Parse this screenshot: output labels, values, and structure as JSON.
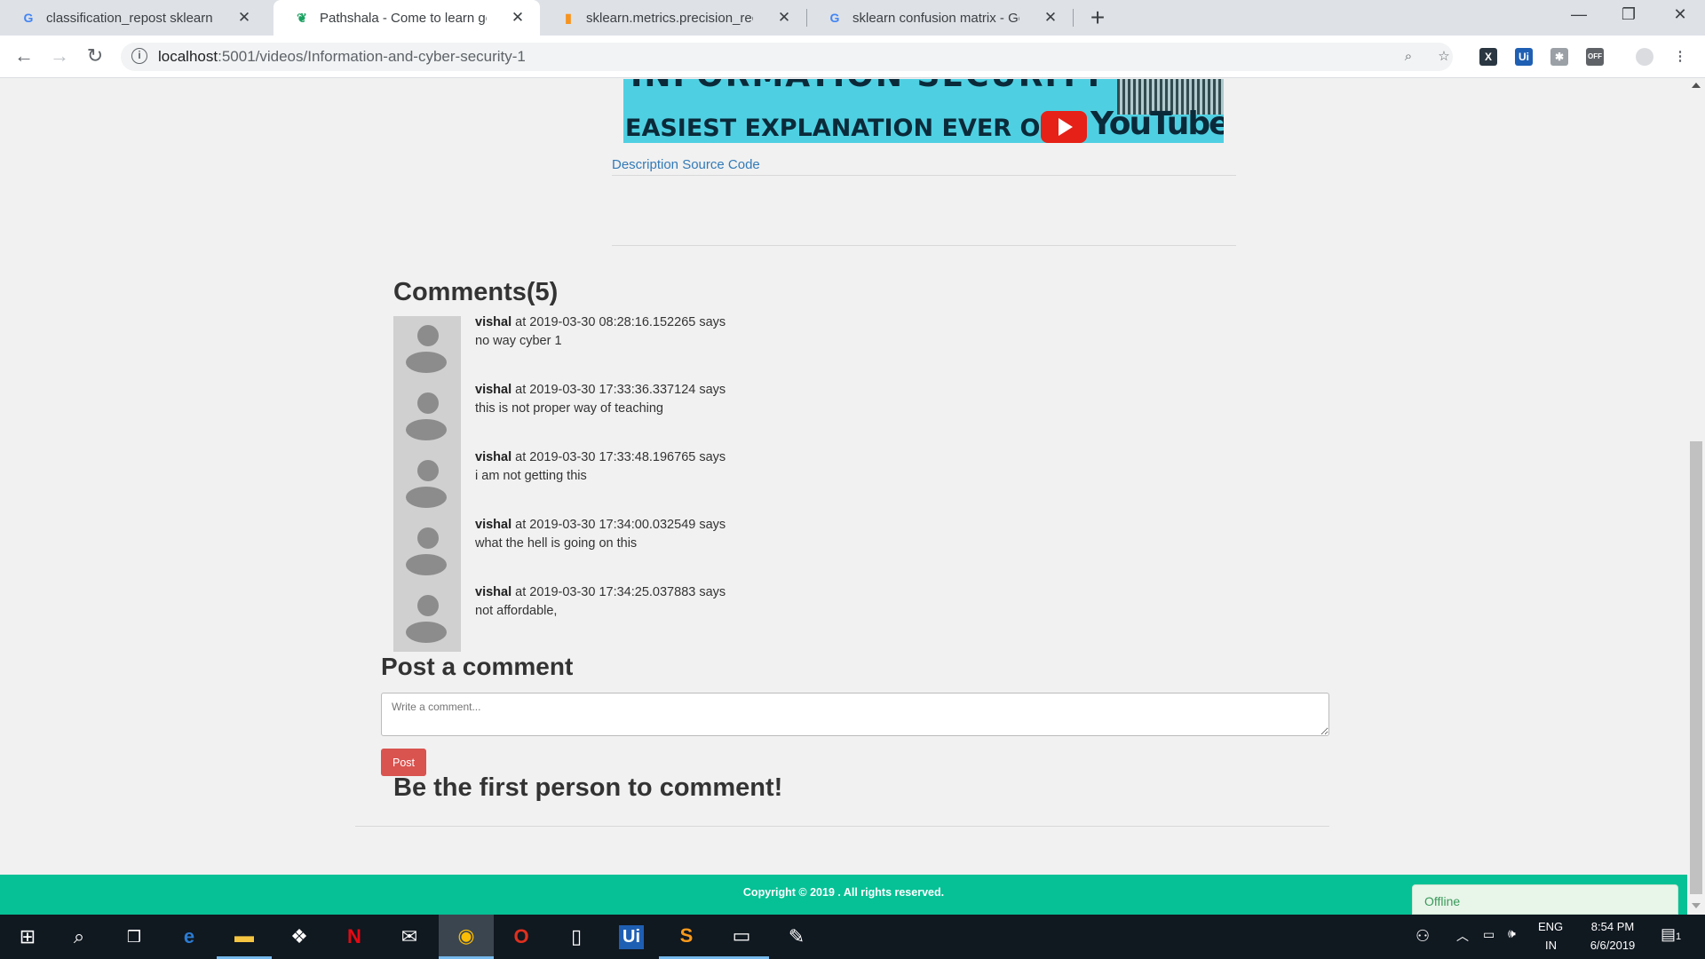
{
  "browser": {
    "tabs": [
      {
        "title": "classification_repost sklearn.metr",
        "icon": "G"
      },
      {
        "title": "Pathshala - Come to learn go to s",
        "icon": "leaf"
      },
      {
        "title": "sklearn.metrics.precision_recall_fs",
        "icon": "scikit"
      },
      {
        "title": "sklearn confusion matrix - Googl",
        "icon": "G"
      }
    ],
    "new_tab": "+",
    "url_host": "localhost",
    "url_rest": ":5001/videos/Information-and-cyber-security-1"
  },
  "thumbnail": {
    "top_text": "INFORMATION SECURITY",
    "bottom_text": "EASIEST EXPLANATION EVER ON",
    "yt_word": "YouTube"
  },
  "description_link": "Description Source Code",
  "comments": {
    "title": "Comments(5)",
    "items": [
      {
        "user": "vishal",
        "meta": "at 2019-03-30 08:28:16.152265 says",
        "text": "no way cyber 1"
      },
      {
        "user": "vishal",
        "meta": "at 2019-03-30 17:33:36.337124 says",
        "text": "this is not proper way of teaching"
      },
      {
        "user": "vishal",
        "meta": "at 2019-03-30 17:33:48.196765 says",
        "text": "i am not getting this"
      },
      {
        "user": "vishal",
        "meta": "at 2019-03-30 17:34:00.032549 says",
        "text": "what the hell is going on this"
      },
      {
        "user": "vishal",
        "meta": "at 2019-03-30 17:34:25.037883 says",
        "text": "not affordable,"
      }
    ]
  },
  "post": {
    "title": "Post a comment",
    "placeholder": "Write a comment...",
    "button": "Post"
  },
  "first_message": "Be the first person to comment!",
  "footer": {
    "copyright": "Copyright © 2019 . All rights reserved."
  },
  "offline": "Offline",
  "taskbar": {
    "lang_top": "ENG",
    "lang_bottom": "IN",
    "time": "8:54 PM",
    "date": "6/6/2019",
    "notif_count": "1"
  },
  "colors": {
    "footer": "#06c195",
    "post_button": "#d9534f",
    "link": "#337ab7"
  }
}
